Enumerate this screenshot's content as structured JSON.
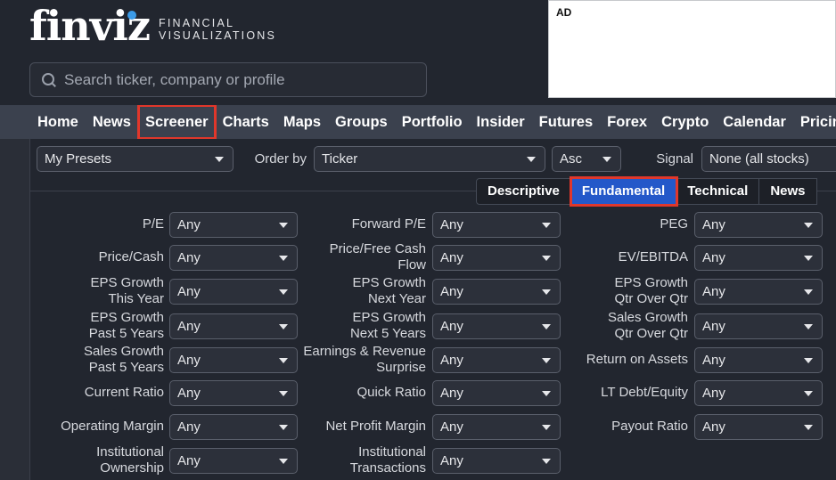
{
  "logo": {
    "word": "finviz",
    "tag_line1": "FINANCIAL",
    "tag_line2": "VISUALIZATIONS"
  },
  "search": {
    "placeholder": "Search ticker, company or profile"
  },
  "ad": {
    "label": "AD"
  },
  "nav": {
    "items": [
      "Home",
      "News",
      "Screener",
      "Charts",
      "Maps",
      "Groups",
      "Portfolio",
      "Insider",
      "Futures",
      "Forex",
      "Crypto",
      "Calendar",
      "Pricing"
    ]
  },
  "controls": {
    "presets": "My Presets",
    "order_by_label": "Order by",
    "order_by_value": "Ticker",
    "order_dir": "Asc",
    "signal_label": "Signal",
    "signal_value": "None (all stocks)"
  },
  "tabs": [
    "Descriptive",
    "Fundamental",
    "Technical",
    "News"
  ],
  "filters": {
    "col1": [
      [
        "P/E"
      ],
      [
        "Price/Cash"
      ],
      [
        "EPS Growth",
        "This Year"
      ],
      [
        "EPS Growth",
        "Past 5 Years"
      ],
      [
        "Sales Growth",
        "Past 5 Years"
      ],
      [
        "Current Ratio"
      ],
      [
        "Operating Margin"
      ],
      [
        "Institutional",
        "Ownership"
      ]
    ],
    "col2": [
      [
        "Forward P/E"
      ],
      [
        "Price/Free Cash",
        "Flow"
      ],
      [
        "EPS Growth",
        "Next Year"
      ],
      [
        "EPS Growth",
        "Next 5 Years"
      ],
      [
        "Earnings & Revenue",
        "Surprise"
      ],
      [
        "Quick Ratio"
      ],
      [
        "Net Profit Margin"
      ],
      [
        "Institutional",
        "Transactions"
      ]
    ],
    "col3": [
      [
        "PEG"
      ],
      [
        "EV/EBITDA"
      ],
      [
        "EPS Growth",
        "Qtr Over Qtr"
      ],
      [
        "Sales Growth",
        "Qtr Over Qtr"
      ],
      [
        "Return on Assets"
      ],
      [
        "LT Debt/Equity"
      ],
      [
        "Payout Ratio"
      ]
    ],
    "any": "Any"
  }
}
